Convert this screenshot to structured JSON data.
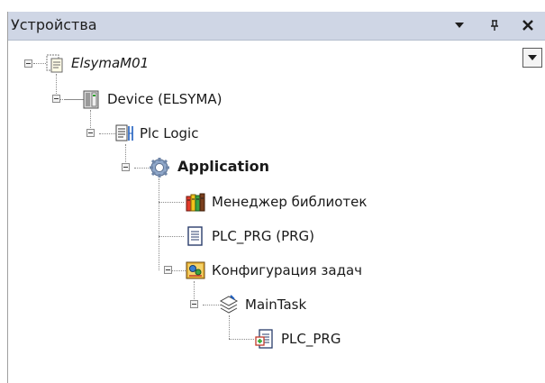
{
  "panel": {
    "title": "Устройства",
    "menu_icon": "dropdown-arrow-icon",
    "pin_icon": "pin-icon",
    "close_icon": "close-icon"
  },
  "tree": {
    "project": {
      "label": "ElsymaM01",
      "icon": "project-icon",
      "expanded": true
    },
    "device": {
      "label": "Device (ELSYMA)",
      "icon": "device-icon",
      "expanded": true
    },
    "plc_logic": {
      "label": "Plc Logic",
      "icon": "plc-logic-icon",
      "expanded": true
    },
    "application": {
      "label": "Application",
      "icon": "application-gear-icon",
      "expanded": true
    },
    "library_manager": {
      "label": "Менеджер библиотек",
      "icon": "library-books-icon"
    },
    "plc_prg": {
      "label": "PLC_PRG (PRG)",
      "icon": "pou-document-icon"
    },
    "task_config": {
      "label": "Конфигурация задач",
      "icon": "task-configuration-icon",
      "expanded": true
    },
    "main_task": {
      "label": "MainTask",
      "icon": "task-stack-icon",
      "expanded": true
    },
    "task_call": {
      "label": "PLC_PRG",
      "icon": "program-call-icon"
    }
  }
}
